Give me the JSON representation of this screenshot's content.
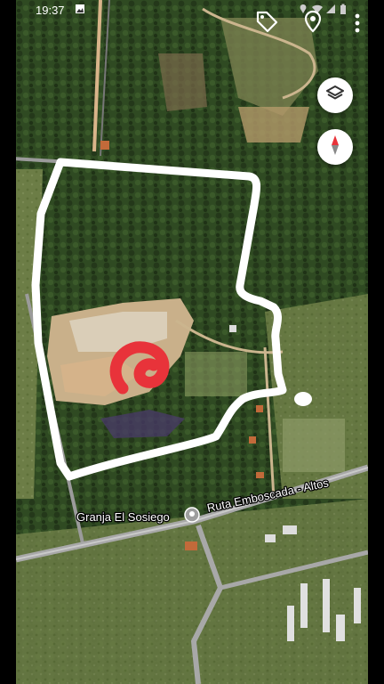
{
  "status_bar": {
    "time": "19:37"
  },
  "map": {
    "place_label": "Granja El Sosiego",
    "road_label": "Ruta Emboscada - Altos"
  },
  "controls": {
    "layers_icon": "layers-icon",
    "compass_icon": "compass-icon",
    "tag_icon": "tag-icon",
    "pin_icon": "location-pin-icon",
    "menu_icon": "more-vert-icon"
  },
  "colors": {
    "boundary": "#ffffff",
    "marker": "#e8333a"
  }
}
